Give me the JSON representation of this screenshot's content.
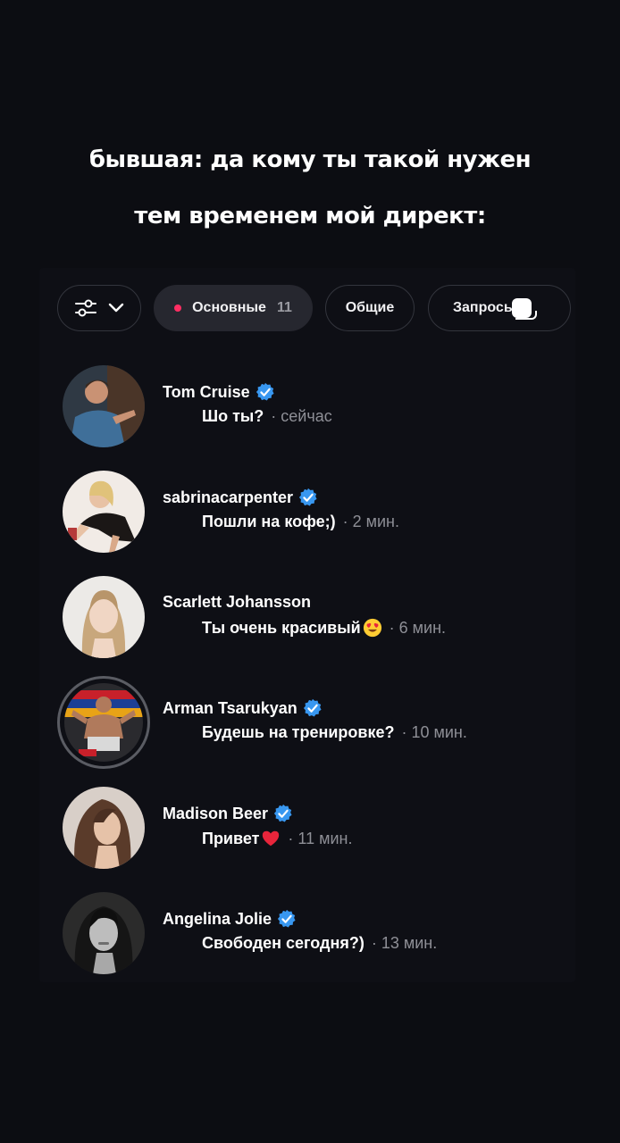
{
  "caption": {
    "line1": "бывшая: да кому ты такой нужен",
    "line2": "тем временем мой директ:"
  },
  "filters": {
    "filter_icon": "sliders-icon",
    "primary_label": "Основные",
    "primary_count": "11",
    "general_label": "Общие",
    "requests_label": "Запросы"
  },
  "colors": {
    "background": "#0c0d12",
    "verified_badge": "#3897f0",
    "unread_dot": "#ff2e63",
    "time_text": "#8e8f96"
  },
  "chats": [
    {
      "name": "Tom Cruise",
      "verified": true,
      "message": "Шо ты?",
      "emoji": "",
      "time": "· сейчас"
    },
    {
      "name": "sabrinacarpenter",
      "verified": true,
      "message": "Пошли на кофе;)",
      "emoji": "",
      "time": "· 2 мин."
    },
    {
      "name": "Scarlett Johansson",
      "verified": false,
      "message": "Ты очень красивый",
      "emoji": "heart-eyes-emoji",
      "time": "· 6 мин."
    },
    {
      "name": "Arman Tsarukyan",
      "verified": true,
      "message": "Будешь на тренировке?",
      "emoji": "",
      "time": "· 10 мин."
    },
    {
      "name": "Madison Beer",
      "verified": true,
      "message": "Привет",
      "emoji": "red-heart-emoji",
      "time": "· 11 мин."
    },
    {
      "name": "Angelina Jolie",
      "verified": true,
      "message": "Свободен сегодня?)",
      "emoji": "",
      "time": "· 13 мин."
    }
  ]
}
